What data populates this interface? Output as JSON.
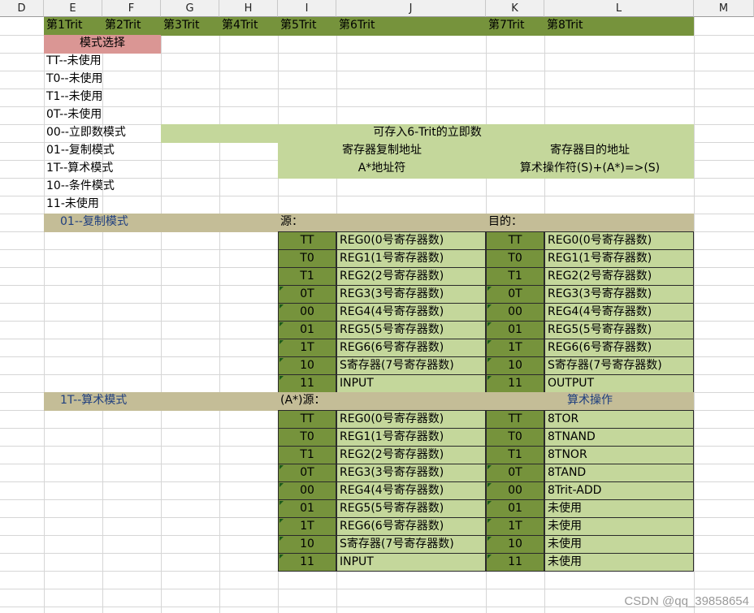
{
  "columns": [
    "D",
    "E",
    "F",
    "G",
    "H",
    "I",
    "J",
    "K",
    "L",
    "M"
  ],
  "header_row": [
    "第1Trit",
    "第2Trit",
    "第3Trit",
    "第4Trit",
    "第5Trit",
    "第6Trit",
    "第7Trit",
    "第8Trit"
  ],
  "mode_select": {
    "title": "模式选择",
    "items": [
      "TT--未使用",
      "T0--未使用",
      "T1--未使用",
      "0T--未使用",
      "00--立即数模式",
      "01--复制模式",
      "1T--算术模式",
      "10--条件模式",
      "11-未使用"
    ]
  },
  "immediate": {
    "label": "可存入6-Trit的立即数"
  },
  "copy_row": {
    "src": "寄存器复制地址",
    "dst": "寄存器目的地址"
  },
  "arith_row": {
    "src": "A*地址符",
    "dst": "算术操作符(S)+(A*)=>(S)"
  },
  "copy_section": {
    "title": "01--复制模式",
    "src_label": "源：",
    "dst_label": "目的：",
    "rows": [
      {
        "code": "TT",
        "src": "REG0(0号寄存器数)",
        "dcode": "TT",
        "dst": "REG0(0号寄存器数)"
      },
      {
        "code": "T0",
        "src": "REG1(1号寄存器数)",
        "dcode": "T0",
        "dst": "REG1(1号寄存器数)"
      },
      {
        "code": "T1",
        "src": "REG2(2号寄存器数)",
        "dcode": "T1",
        "dst": "REG2(2号寄存器数)"
      },
      {
        "code": "0T",
        "src": "REG3(3号寄存器数)",
        "dcode": "0T",
        "dst": "REG3(3号寄存器数)"
      },
      {
        "code": "00",
        "src": "REG4(4号寄存器数)",
        "dcode": "00",
        "dst": "REG4(4号寄存器数)"
      },
      {
        "code": "01",
        "src": "REG5(5号寄存器数)",
        "dcode": "01",
        "dst": "REG5(5号寄存器数)"
      },
      {
        "code": "1T",
        "src": "REG6(6号寄存器数)",
        "dcode": "1T",
        "dst": "REG6(6号寄存器数)"
      },
      {
        "code": "10",
        "src": "S寄存器(7号寄存器数)",
        "dcode": "10",
        "dst": "S寄存器(7号寄存器数)"
      },
      {
        "code": "11",
        "src": "INPUT",
        "dcode": "11",
        "dst": "OUTPUT"
      }
    ]
  },
  "arith_section": {
    "title": "1T--算术模式",
    "src_label": "(A*)源：",
    "dst_label": "算术操作",
    "rows": [
      {
        "code": "TT",
        "src": "REG0(0号寄存器数)",
        "dcode": "TT",
        "dst": "8TOR"
      },
      {
        "code": "T0",
        "src": "REG1(1号寄存器数)",
        "dcode": "T0",
        "dst": "8TNAND"
      },
      {
        "code": "T1",
        "src": "REG2(2号寄存器数)",
        "dcode": "T1",
        "dst": "8TNOR"
      },
      {
        "code": "0T",
        "src": "REG3(3号寄存器数)",
        "dcode": "0T",
        "dst": "8TAND"
      },
      {
        "code": "00",
        "src": "REG4(4号寄存器数)",
        "dcode": "00",
        "dst": "8Trit-ADD"
      },
      {
        "code": "01",
        "src": "REG5(5号寄存器数)",
        "dcode": "01",
        "dst": "未使用"
      },
      {
        "code": "1T",
        "src": "REG6(6号寄存器数)",
        "dcode": "1T",
        "dst": "未使用"
      },
      {
        "code": "10",
        "src": "S寄存器(7号寄存器数)",
        "dcode": "10",
        "dst": "未使用"
      },
      {
        "code": "11",
        "src": "INPUT",
        "dcode": "11",
        "dst": "未使用"
      }
    ]
  },
  "watermark": "CSDN @qq_39858654",
  "colors": {
    "dark_green": "#76933c",
    "light_green": "#c4d79b",
    "pink": "#da9694",
    "tan": "#c4bd97"
  }
}
